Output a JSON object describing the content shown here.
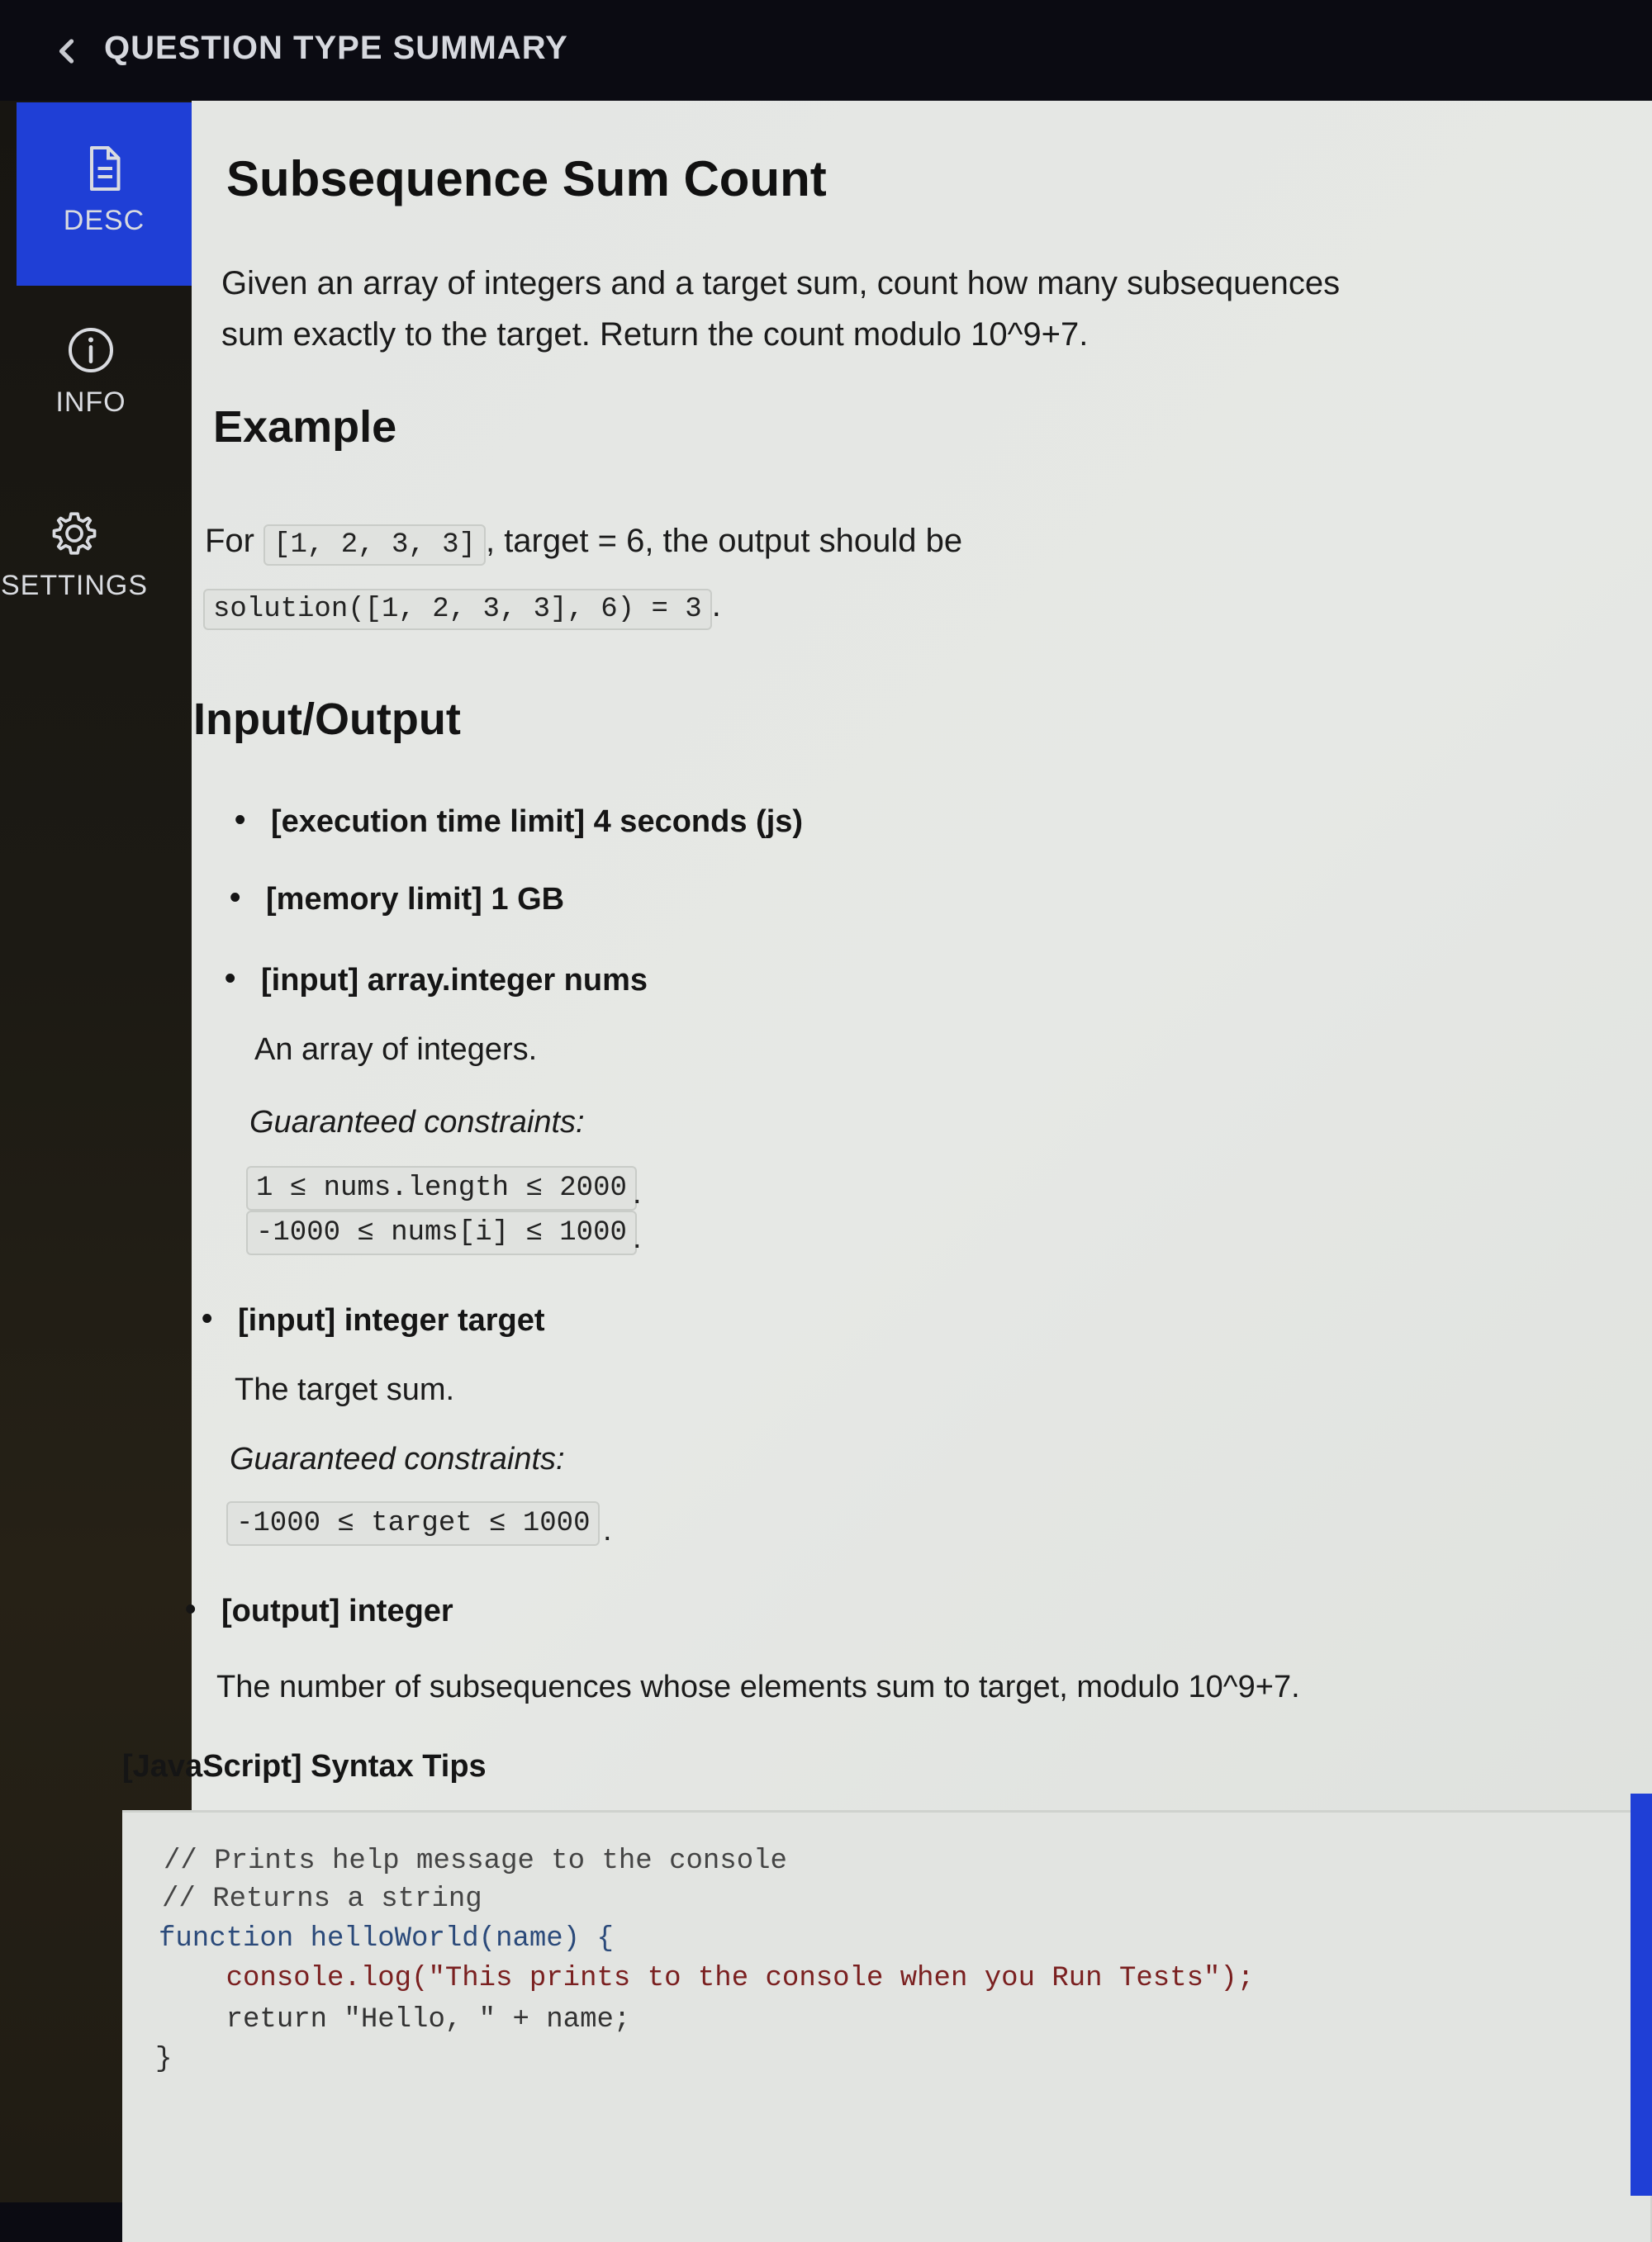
{
  "header": {
    "title": "QUESTION TYPE SUMMARY"
  },
  "sidebar": {
    "items": [
      {
        "label": "DESC",
        "icon": "document-icon",
        "active": true
      },
      {
        "label": "INFO",
        "icon": "info-icon",
        "active": false
      },
      {
        "label": "SETTINGS",
        "icon": "gear-icon",
        "active": false
      }
    ]
  },
  "problem": {
    "title": "Subsequence Sum Count",
    "description_line1": "Given an array of integers and a target sum, count how many subsequences",
    "description_line2": "sum exactly to the target. Return the count modulo 10^9+7.",
    "example_heading": "Example",
    "example_for": "For",
    "example_array": "[1, 2, 3, 3]",
    "example_target": ", target = 6, the output should be",
    "example_solution": "solution([1, 2, 3, 3], 6) = 3",
    "io_heading": "Input/Output"
  },
  "io": {
    "time_limit": "[execution time limit] 4 seconds (js)",
    "memory_limit": "[memory limit] 1 GB",
    "input1": "[input] array.integer nums",
    "input1_desc": "An array of integers.",
    "input1_constraints_label": "Guaranteed constraints:",
    "input1_c1": "1 ≤ nums.length ≤ 2000",
    "input1_c2": "-1000 ≤ nums[i] ≤ 1000",
    "input2": "[input] integer target",
    "input2_desc": "The target sum.",
    "input2_constraints_label": "Guaranteed constraints:",
    "input2_c1": "-1000 ≤ target ≤ 1000",
    "output": "[output] integer",
    "output_desc": "The number of subsequences whose elements sum to target, modulo 10^9+7."
  },
  "tips": {
    "title": "[JavaScript] Syntax Tips",
    "code": [
      "// Prints help message to the console",
      "// Returns a string",
      "function helloWorld(name) {",
      "    console.log(\"This prints to the console when you Run Tests\");",
      "    return \"Hello, \" + name;",
      "}"
    ]
  },
  "colors": {
    "accent": "#1f3fd6",
    "background": "#e4e6e3",
    "topbar": "#0b0b12"
  }
}
